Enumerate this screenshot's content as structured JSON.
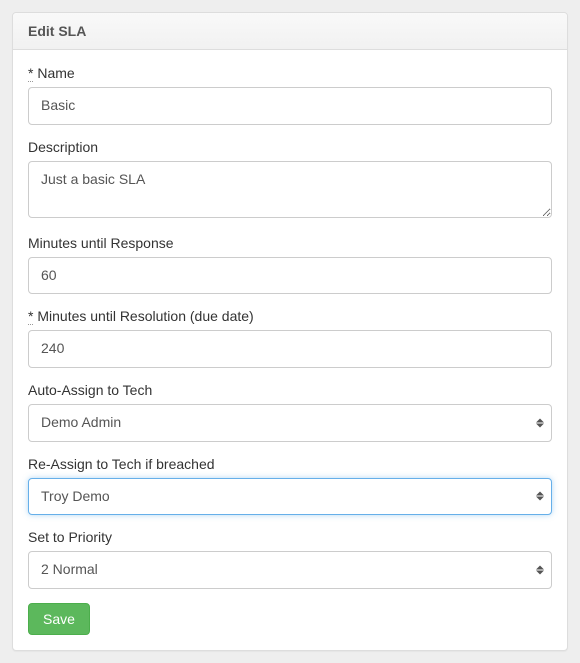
{
  "panel": {
    "title": "Edit SLA"
  },
  "form": {
    "name": {
      "label": "Name",
      "value": "Basic",
      "required": true
    },
    "description": {
      "label": "Description",
      "value": "Just a basic SLA"
    },
    "minutes_response": {
      "label": "Minutes until Response",
      "value": "60"
    },
    "minutes_resolution": {
      "label": "Minutes until Resolution (due date)",
      "value": "240",
      "required": true
    },
    "auto_assign": {
      "label": "Auto-Assign to Tech",
      "value": "Demo Admin"
    },
    "reassign": {
      "label": "Re-Assign to Tech if breached",
      "value": "Troy Demo"
    },
    "priority": {
      "label": "Set to Priority",
      "value": "2 Normal"
    },
    "save_label": "Save"
  }
}
